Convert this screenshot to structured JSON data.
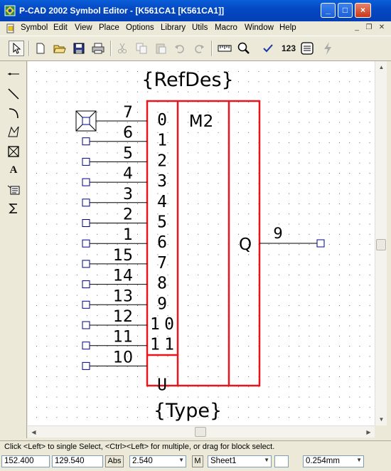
{
  "window": {
    "title": "P-CAD 2002 Symbol Editor - [K561CA1 [K561CA1]]",
    "minimize_label": "_",
    "maximize_label": "□",
    "close_label": "×"
  },
  "menu": {
    "items": [
      "Symbol",
      "Edit",
      "View",
      "Place",
      "Options",
      "Library",
      "Utils",
      "Macro",
      "Window",
      "Help"
    ]
  },
  "toolbar": {
    "tools": [
      "select",
      "new-document",
      "open-folder",
      "save",
      "print",
      "cut",
      "copy",
      "paste",
      "undo",
      "redo",
      "measure",
      "zoom",
      "check",
      "renumber",
      "layer-list",
      "lightning"
    ],
    "renumber_label": "123"
  },
  "palette": {
    "tools": [
      "place-pin",
      "place-line",
      "place-arc",
      "place-polygon",
      "place-point",
      "place-text",
      "place-attribute",
      "place-field"
    ],
    "text_tool_label": "A"
  },
  "symbol": {
    "refdes": "{RefDes}",
    "type": "{Type}",
    "function_label": "M2",
    "output_label": "Q",
    "output_pin_number": "9",
    "input_pin_numbers": [
      "7",
      "6",
      "5",
      "4",
      "3",
      "2",
      "1",
      "15",
      "14",
      "13",
      "12",
      "11",
      "10"
    ],
    "input_pin_labels": [
      "0",
      "1",
      "2",
      "3",
      "4",
      "5",
      "6",
      "7",
      "8",
      "9",
      "10",
      "11",
      "U"
    ],
    "colors": {
      "outline": "#e8141e",
      "pin_line": "#000000",
      "pin_marker": "#00008b",
      "grid": "#666666"
    }
  },
  "status": {
    "message": "Click <Left> to single Select, <Ctrl><Left> for multiple, or drag for block select.",
    "x_coord": "152.400",
    "y_coord": "129.540",
    "abs_label": "Abs",
    "grid": "2.540",
    "mode_label": "M",
    "sheet": "Sheet1",
    "line_width": "0.254mm"
  }
}
